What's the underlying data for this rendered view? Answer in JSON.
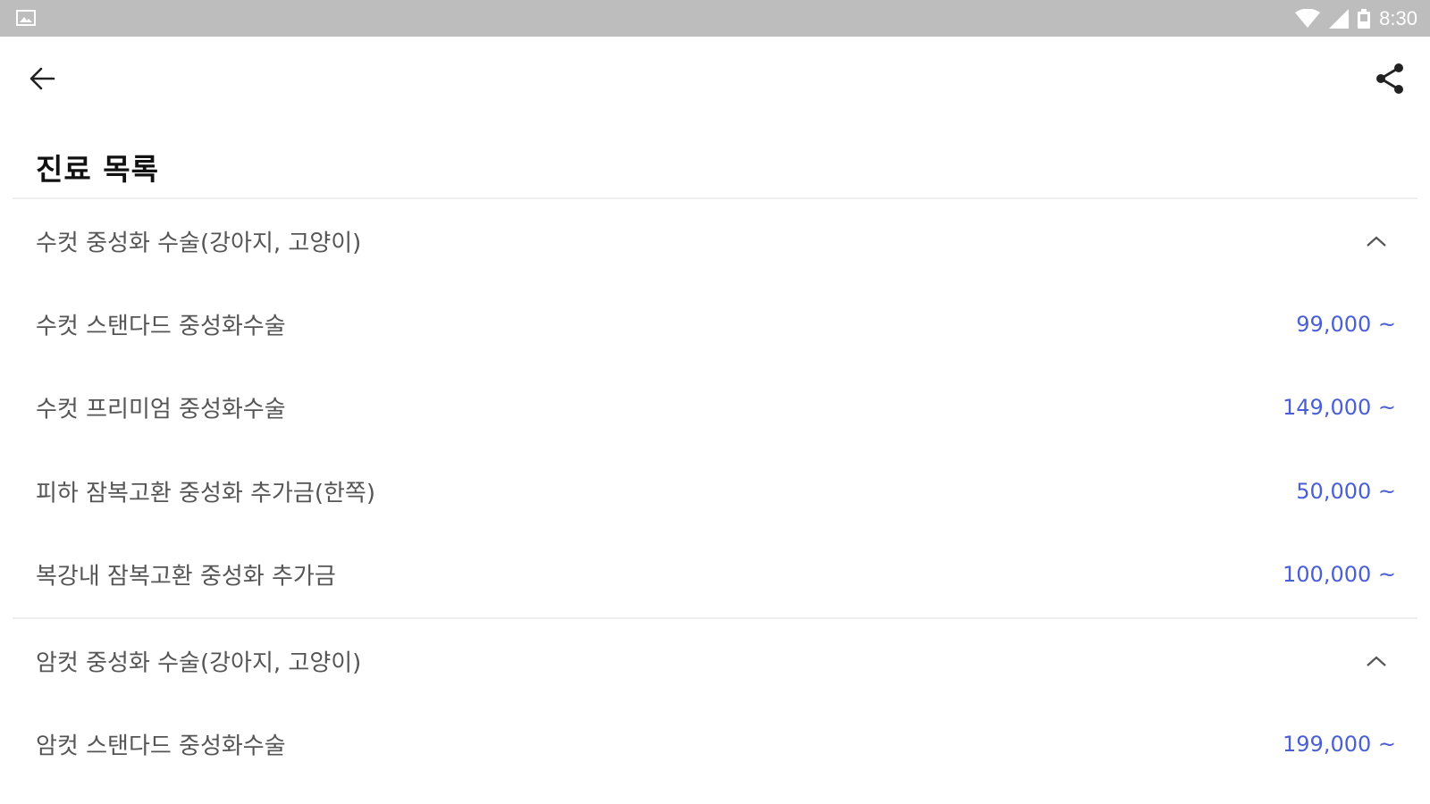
{
  "status_bar": {
    "time": "8:30",
    "left_icon": "image-notification-icon",
    "icons": [
      "wifi-icon",
      "cellular-signal-icon",
      "battery-icon"
    ]
  },
  "app_bar": {
    "back_icon": "arrow-back-icon",
    "share_icon": "share-icon"
  },
  "page": {
    "title": "진료 목록"
  },
  "sections": [
    {
      "title": "수컷 중성화 수술(강아지, 고양이)",
      "expanded": true,
      "items": [
        {
          "name": "수컷 스탠다드 중성화수술",
          "price": "99,000 ~"
        },
        {
          "name": "수컷 프리미엄 중성화수술",
          "price": "149,000 ~"
        },
        {
          "name": "피하 잠복고환 중성화 추가금(한쪽)",
          "price": "50,000 ~"
        },
        {
          "name": "복강내 잠복고환 중성화 추가금",
          "price": "100,000 ~"
        }
      ]
    },
    {
      "title": "암컷 중성화 수술(강아지, 고양이)",
      "expanded": true,
      "items": [
        {
          "name": "암컷 스탠다드 중성화수술",
          "price": "199,000 ~"
        }
      ]
    }
  ],
  "colors": {
    "status_bar": "#bdbdbd",
    "price": "#4a5fd6",
    "divider": "#eeeeee"
  }
}
